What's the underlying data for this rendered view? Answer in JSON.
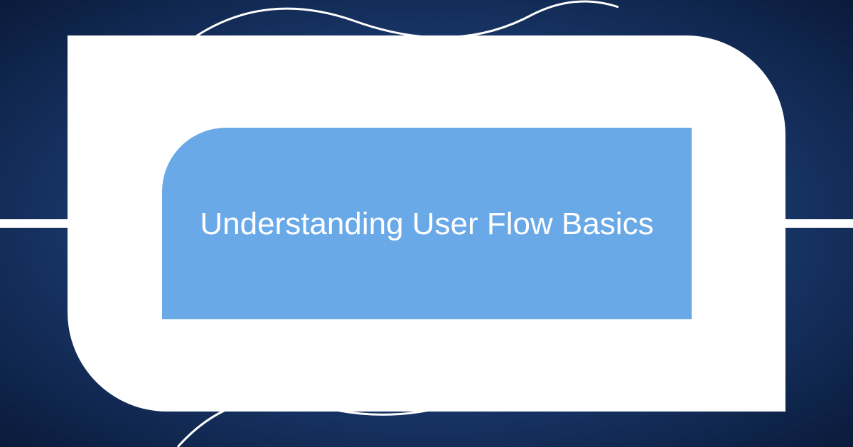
{
  "title": "Understanding User Flow Basics",
  "colors": {
    "background_inner": "#5a9be8",
    "background_outer": "#0a1a3a",
    "frame": "#ffffff",
    "panel": "#6aa9e8",
    "text": "#ffffff",
    "curve_stroke": "#ffffff"
  }
}
